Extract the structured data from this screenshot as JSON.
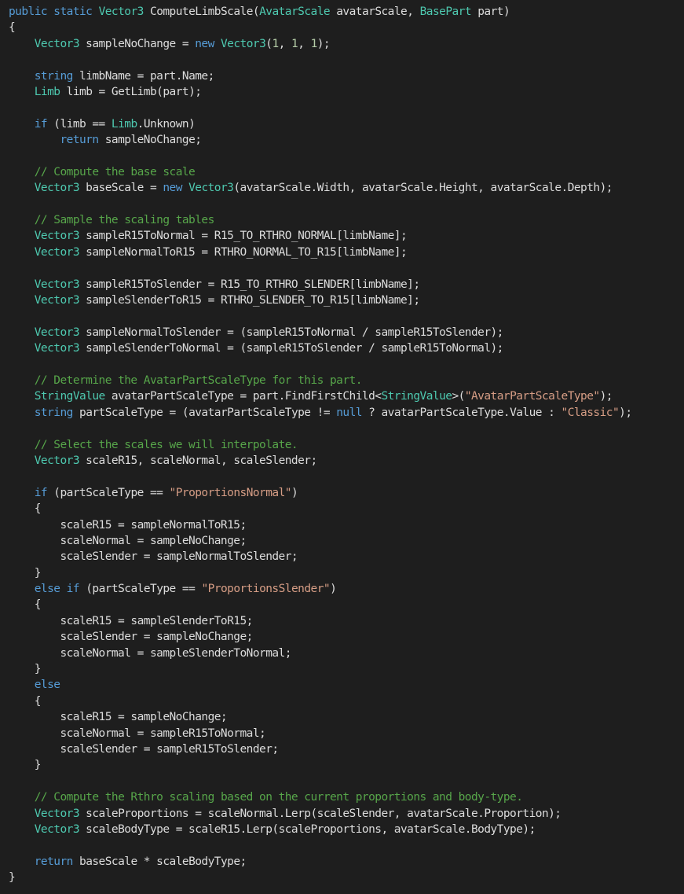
{
  "editor": {
    "language": "csharp",
    "colors": {
      "background": "#1e1e1e",
      "plain": "#dcdcdc",
      "kw": "#569cd6",
      "type": "#4ec9b0",
      "str": "#d69d85",
      "comment": "#57a64a",
      "num": "#b5cea8"
    },
    "lines": [
      [
        [
          "kw",
          "public"
        ],
        [
          "plain",
          " "
        ],
        [
          "kw",
          "static"
        ],
        [
          "plain",
          " "
        ],
        [
          "type",
          "Vector3"
        ],
        [
          "plain",
          " ComputeLimbScale("
        ],
        [
          "type",
          "AvatarScale"
        ],
        [
          "plain",
          " avatarScale, "
        ],
        [
          "type",
          "BasePart"
        ],
        [
          "plain",
          " part)"
        ]
      ],
      [
        [
          "plain",
          "{"
        ]
      ],
      [
        [
          "plain",
          "    "
        ],
        [
          "type",
          "Vector3"
        ],
        [
          "plain",
          " sampleNoChange = "
        ],
        [
          "kw",
          "new"
        ],
        [
          "plain",
          " "
        ],
        [
          "type",
          "Vector3"
        ],
        [
          "plain",
          "("
        ],
        [
          "num",
          "1"
        ],
        [
          "plain",
          ", "
        ],
        [
          "num",
          "1"
        ],
        [
          "plain",
          ", "
        ],
        [
          "num",
          "1"
        ],
        [
          "plain",
          ");"
        ]
      ],
      [],
      [
        [
          "plain",
          "    "
        ],
        [
          "kw",
          "string"
        ],
        [
          "plain",
          " limbName = part.Name;"
        ]
      ],
      [
        [
          "plain",
          "    "
        ],
        [
          "type",
          "Limb"
        ],
        [
          "plain",
          " limb = GetLimb(part);"
        ]
      ],
      [],
      [
        [
          "plain",
          "    "
        ],
        [
          "kw",
          "if"
        ],
        [
          "plain",
          " (limb == "
        ],
        [
          "type",
          "Limb"
        ],
        [
          "plain",
          ".Unknown)"
        ]
      ],
      [
        [
          "plain",
          "        "
        ],
        [
          "kw",
          "return"
        ],
        [
          "plain",
          " sampleNoChange;"
        ]
      ],
      [],
      [
        [
          "plain",
          "    "
        ],
        [
          "comment",
          "// Compute the base scale"
        ]
      ],
      [
        [
          "plain",
          "    "
        ],
        [
          "type",
          "Vector3"
        ],
        [
          "plain",
          " baseScale = "
        ],
        [
          "kw",
          "new"
        ],
        [
          "plain",
          " "
        ],
        [
          "type",
          "Vector3"
        ],
        [
          "plain",
          "(avatarScale.Width, avatarScale.Height, avatarScale.Depth);"
        ]
      ],
      [],
      [
        [
          "plain",
          "    "
        ],
        [
          "comment",
          "// Sample the scaling tables"
        ]
      ],
      [
        [
          "plain",
          "    "
        ],
        [
          "type",
          "Vector3"
        ],
        [
          "plain",
          " sampleR15ToNormal = R15_TO_RTHRO_NORMAL[limbName];"
        ]
      ],
      [
        [
          "plain",
          "    "
        ],
        [
          "type",
          "Vector3"
        ],
        [
          "plain",
          " sampleNormalToR15 = RTHRO_NORMAL_TO_R15[limbName];"
        ]
      ],
      [],
      [
        [
          "plain",
          "    "
        ],
        [
          "type",
          "Vector3"
        ],
        [
          "plain",
          " sampleR15ToSlender = R15_TO_RTHRO_SLENDER[limbName];"
        ]
      ],
      [
        [
          "plain",
          "    "
        ],
        [
          "type",
          "Vector3"
        ],
        [
          "plain",
          " sampleSlenderToR15 = RTHRO_SLENDER_TO_R15[limbName];"
        ]
      ],
      [],
      [
        [
          "plain",
          "    "
        ],
        [
          "type",
          "Vector3"
        ],
        [
          "plain",
          " sampleNormalToSlender = (sampleR15ToNormal / sampleR15ToSlender);"
        ]
      ],
      [
        [
          "plain",
          "    "
        ],
        [
          "type",
          "Vector3"
        ],
        [
          "plain",
          " sampleSlenderToNormal = (sampleR15ToSlender / sampleR15ToNormal);"
        ]
      ],
      [],
      [
        [
          "plain",
          "    "
        ],
        [
          "comment",
          "// Determine the AvatarPartScaleType for this part."
        ]
      ],
      [
        [
          "plain",
          "    "
        ],
        [
          "type",
          "StringValue"
        ],
        [
          "plain",
          " avatarPartScaleType = part.FindFirstChild<"
        ],
        [
          "type",
          "StringValue"
        ],
        [
          "plain",
          ">("
        ],
        [
          "str",
          "\"AvatarPartScaleType\""
        ],
        [
          "plain",
          ");"
        ]
      ],
      [
        [
          "plain",
          "    "
        ],
        [
          "kw",
          "string"
        ],
        [
          "plain",
          " partScaleType = (avatarPartScaleType != "
        ],
        [
          "kw",
          "null"
        ],
        [
          "plain",
          " ? avatarPartScaleType.Value : "
        ],
        [
          "str",
          "\"Classic\""
        ],
        [
          "plain",
          ");"
        ]
      ],
      [],
      [
        [
          "plain",
          "    "
        ],
        [
          "comment",
          "// Select the scales we will interpolate."
        ]
      ],
      [
        [
          "plain",
          "    "
        ],
        [
          "type",
          "Vector3"
        ],
        [
          "plain",
          " scaleR15, scaleNormal, scaleSlender;"
        ]
      ],
      [],
      [
        [
          "plain",
          "    "
        ],
        [
          "kw",
          "if"
        ],
        [
          "plain",
          " (partScaleType == "
        ],
        [
          "str",
          "\"ProportionsNormal\""
        ],
        [
          "plain",
          ")"
        ]
      ],
      [
        [
          "plain",
          "    {"
        ]
      ],
      [
        [
          "plain",
          "        scaleR15 = sampleNormalToR15;"
        ]
      ],
      [
        [
          "plain",
          "        scaleNormal = sampleNoChange;"
        ]
      ],
      [
        [
          "plain",
          "        scaleSlender = sampleNormalToSlender;"
        ]
      ],
      [
        [
          "plain",
          "    }"
        ]
      ],
      [
        [
          "plain",
          "    "
        ],
        [
          "kw",
          "else"
        ],
        [
          "plain",
          " "
        ],
        [
          "kw",
          "if"
        ],
        [
          "plain",
          " (partScaleType == "
        ],
        [
          "str",
          "\"ProportionsSlender\""
        ],
        [
          "plain",
          ")"
        ]
      ],
      [
        [
          "plain",
          "    {"
        ]
      ],
      [
        [
          "plain",
          "        scaleR15 = sampleSlenderToR15;"
        ]
      ],
      [
        [
          "plain",
          "        scaleSlender = sampleNoChange;"
        ]
      ],
      [
        [
          "plain",
          "        scaleNormal = sampleSlenderToNormal;"
        ]
      ],
      [
        [
          "plain",
          "    }"
        ]
      ],
      [
        [
          "plain",
          "    "
        ],
        [
          "kw",
          "else"
        ]
      ],
      [
        [
          "plain",
          "    {"
        ]
      ],
      [
        [
          "plain",
          "        scaleR15 = sampleNoChange;"
        ]
      ],
      [
        [
          "plain",
          "        scaleNormal = sampleR15ToNormal;"
        ]
      ],
      [
        [
          "plain",
          "        scaleSlender = sampleR15ToSlender;"
        ]
      ],
      [
        [
          "plain",
          "    }"
        ]
      ],
      [],
      [
        [
          "plain",
          "    "
        ],
        [
          "comment",
          "// Compute the Rthro scaling based on the current proportions and body-type."
        ]
      ],
      [
        [
          "plain",
          "    "
        ],
        [
          "type",
          "Vector3"
        ],
        [
          "plain",
          " scaleProportions = scaleNormal.Lerp(scaleSlender, avatarScale.Proportion);"
        ]
      ],
      [
        [
          "plain",
          "    "
        ],
        [
          "type",
          "Vector3"
        ],
        [
          "plain",
          " scaleBodyType = scaleR15.Lerp(scaleProportions, avatarScale.BodyType);"
        ]
      ],
      [],
      [
        [
          "plain",
          "    "
        ],
        [
          "kw",
          "return"
        ],
        [
          "plain",
          " baseScale * scaleBodyType;"
        ]
      ],
      [
        [
          "plain",
          "}"
        ]
      ]
    ]
  }
}
